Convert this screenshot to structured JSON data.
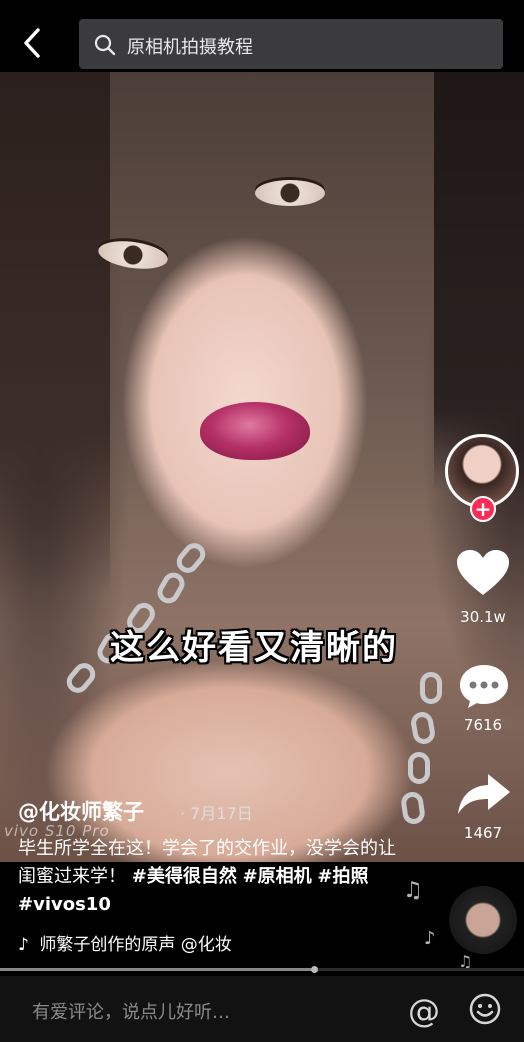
{
  "search": {
    "query": "原相机拍摄教程"
  },
  "video": {
    "overlay_caption": "这么好看又清晰的",
    "watermark": "vivo S10 Pro"
  },
  "actions": {
    "likes": "30.1w",
    "comments": "7616",
    "shares": "1467",
    "follow_symbol": "+"
  },
  "post": {
    "author": "@化妆师繁子",
    "date": "· 7月17日",
    "description": "毕生所学全在这！学会了的交作业，没学会的让闺蜜过来学！",
    "hashtags": [
      "#美得很自然",
      "#原相机",
      "#拍照",
      "#vivos10"
    ],
    "music_text": "师繁子创作的原声    @化妆"
  },
  "comment_bar": {
    "placeholder": "有爱评论，说点儿好听…",
    "at_symbol": "@"
  },
  "progress": {
    "played_fraction": 0.6
  },
  "colors": {
    "follow": "#fe2c55",
    "background": "#000000",
    "search_bg": "#3b3b3d"
  },
  "icons": [
    "back-icon",
    "search-icon",
    "heart-icon",
    "comment-icon",
    "share-icon",
    "tiktok-note-icon",
    "music-disc-icon",
    "at-icon",
    "emoji-icon"
  ]
}
